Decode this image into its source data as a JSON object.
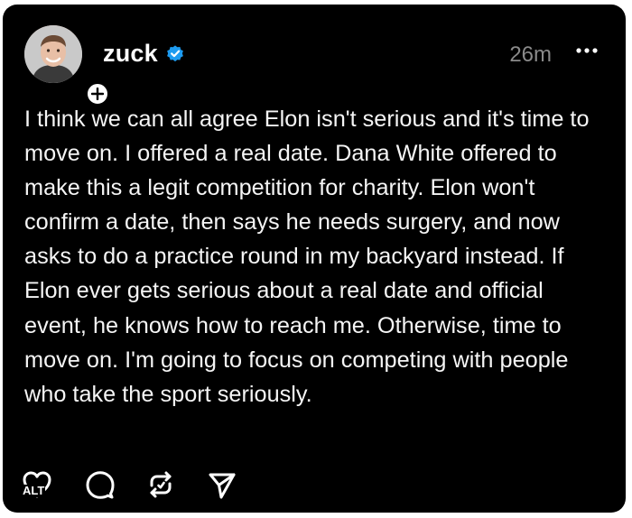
{
  "post": {
    "username": "zuck",
    "time": "26m",
    "text": "I think we can all agree Elon isn't serious and it's time to move on. I offered a real date. Dana White offered to make this a legit competition for charity. Elon won't confirm a date, then says he needs surgery, and now asks to do a practice round in my backyard instead. If Elon ever gets serious about a real date and official event, he knows how to reach me. Otherwise, time to move on. I'm going to focus on competing with people who take the sport seriously.",
    "alt_label": "ALT"
  },
  "icons": {
    "verified": "verified-badge-icon",
    "follow": "plus-icon",
    "more": "more-horizontal-icon",
    "like": "heart-icon",
    "reply": "comment-icon",
    "repost": "repost-icon",
    "share": "send-icon"
  },
  "colors": {
    "background": "#000000",
    "text": "#f5f5f5",
    "muted": "#8a8a8a",
    "verified": "#1d9bf0"
  }
}
